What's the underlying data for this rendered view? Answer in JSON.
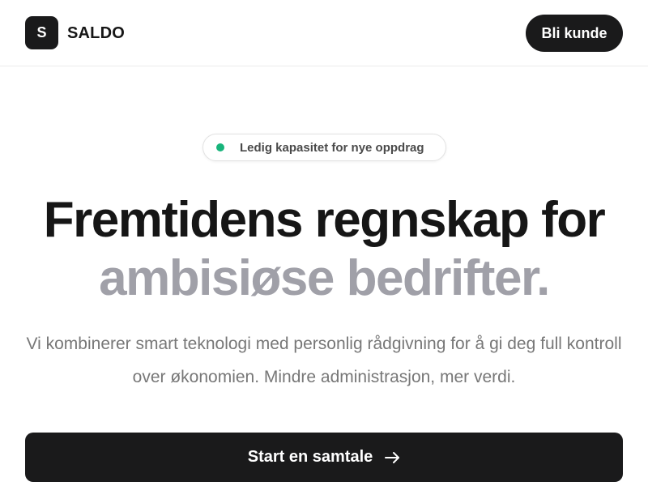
{
  "header": {
    "logo_letter": "S",
    "brand_name": "SALDO",
    "cta_label": "Bli kunde"
  },
  "badge": {
    "text": "Ledig kapasitet for nye oppdrag",
    "dot_color": "#18b47b"
  },
  "hero": {
    "headline_line1": "Fremtidens regnskap for",
    "headline_line2": "ambisiøse bedrifter.",
    "subtext": "Vi kombinerer smart teknologi med personlig rådgivning for å gi deg full kontroll over økonomien. Mindre administrasjon, mer verdi.",
    "cta_label": "Start en samtale",
    "cta_icon": "arrow-right-icon"
  },
  "colors": {
    "dark": "#1a1a1b",
    "muted_headline": "#a0a0a8",
    "body_text": "#777777",
    "accent_green": "#18b47b"
  }
}
